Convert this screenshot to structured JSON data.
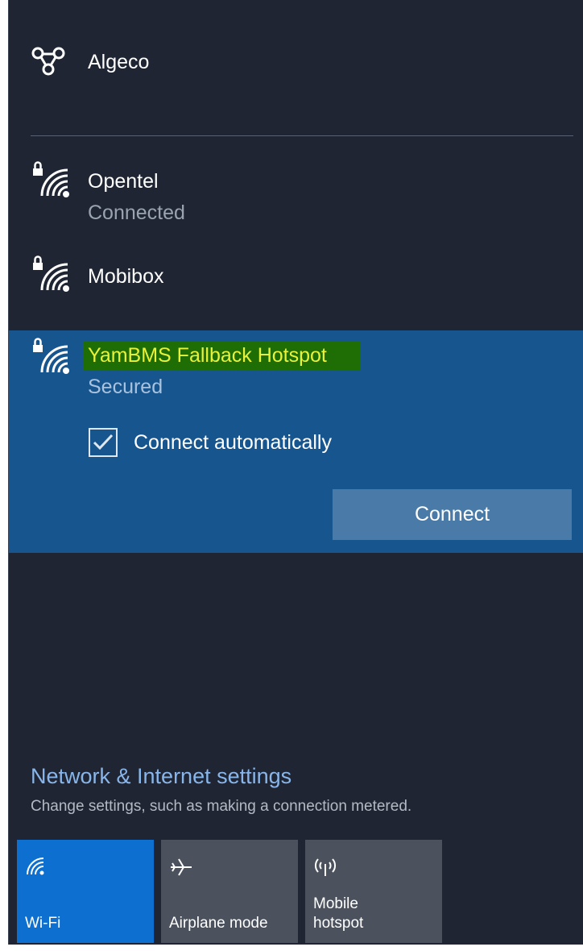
{
  "networks": [
    {
      "name": "Algeco",
      "status": ""
    },
    {
      "name": "Opentel",
      "status": "Connected"
    },
    {
      "name": "Mobibox",
      "status": ""
    },
    {
      "name": "YamBMS Fallback Hotspot",
      "status": "Secured"
    }
  ],
  "selected": {
    "connect_auto_label": "Connect automatically",
    "connect_auto_checked": true,
    "connect_button": "Connect"
  },
  "settings": {
    "link": "Network & Internet settings",
    "description": "Change settings, such as making a connection metered."
  },
  "quick_actions": [
    {
      "label": "Wi-Fi",
      "icon": "wifi-icon",
      "active": true
    },
    {
      "label": "Airplane mode",
      "icon": "airplane-icon",
      "active": false
    },
    {
      "label": "Mobile\nhotspot",
      "icon": "mobile-hotspot-icon",
      "active": false
    }
  ],
  "colors": {
    "panel_bg": "#1f2533",
    "selected_bg": "#17558f",
    "highlight_bg": "#1f6d05",
    "highlight_text": "#e8f23a",
    "accent": "#0d6fd0",
    "link": "#89b6ea"
  }
}
